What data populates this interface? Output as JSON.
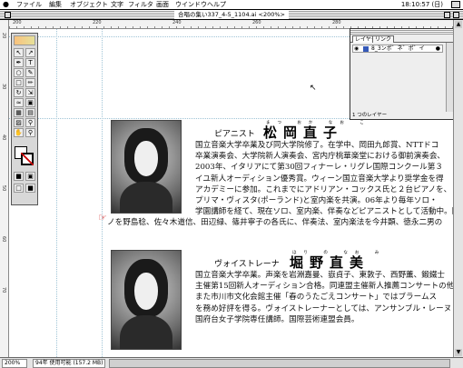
{
  "menubar": {
    "apple": "",
    "items": [
      "ファイル",
      "編集",
      "オブジェクト",
      "文字",
      "フィルタ",
      "画面",
      "ウインドウ",
      "ヘルプ"
    ],
    "clock": "18:10:57 (日)"
  },
  "window": {
    "title": "合唱の集い337_4-5_1104.ai <200%>"
  },
  "ruler": {
    "h": [
      "200",
      "220",
      "240",
      "260",
      "280"
    ],
    "v": [
      "20",
      "30",
      "40",
      "50",
      "60",
      "70"
    ]
  },
  "layers": {
    "tabs": [
      "レイヤー",
      "リンク"
    ],
    "row_label": "8_3ンポ゛ネ゛ポ゛イ",
    "footer": "1 つのレイヤー"
  },
  "performer1": {
    "role": "ピアニスト",
    "name": "松岡直子",
    "ruby": "まつ おか なお こ",
    "bio": [
      "国立音楽大学卒業及び同大学院修了。在学中、岡田九郎賞、NTTドコ",
      "卒業演奏会、大学院新人演奏会、宮内庁桃華楽堂における御前演奏会、",
      "2003年、イタリアにて第30回フィナーレ・リグレ国際コンクール第３",
      "イユ新人オーディション優秀賞。ウィーン国立音楽大学より奨学金を得",
      "アカデミーに参加。これまでにアドリアン・コックス氏と２台ピアノを、",
      "プリマ・ヴィスタ(ポーランド)と室内楽を共演。06年より毎年ソロ・",
      "学園講師を経て、現在ソロ、室内楽、伴奏などピアニストとして活動中。国",
      "ノを野島稔、佐々木道信、田辺緑、篠井寧子の各氏に、伴奏法、室内楽法を今井顕、徳永二男の"
    ]
  },
  "performer2": {
    "role": "ヴォイストレーナ",
    "name": "堀野直美",
    "ruby": "ほり の なお み",
    "bio": [
      "国立音楽大学卒業。声楽を岩淵嘉曼、嶽貞子、東敦子、西野薫、鍛鐵士",
      "主催第15回新人オーディション合格。同連盟主催新人推薦コンサートの他",
      "また市川市文化会館主催「春のうたごえコンサート」ではブラームス",
      "を務め好評を得る。ヴォイストレーナーとしては、アンサンブル・レーヌ",
      "国府台女子学院専任講師。国際芸術連盟会員。"
    ]
  },
  "status": {
    "zoom": "200%",
    "info": "94年 使用可能 (157.2 MB)"
  }
}
